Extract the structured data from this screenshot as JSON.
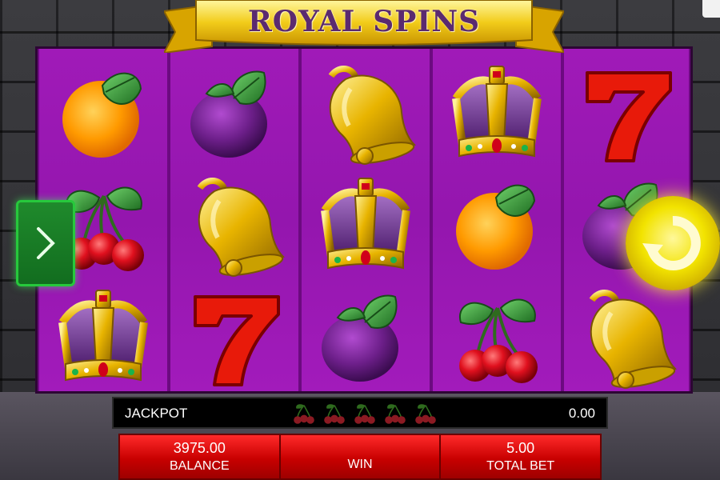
{
  "game": {
    "title": "ROYAL SPINS",
    "colors": {
      "reel": "#9c18b4",
      "accent": "#f4d000",
      "panel": "#e00000"
    }
  },
  "reels": [
    [
      "orange",
      "cherries",
      "crown"
    ],
    [
      "plum",
      "bell",
      "seven"
    ],
    [
      "bell",
      "crown",
      "plum"
    ],
    [
      "crown",
      "orange",
      "cherries"
    ],
    [
      "seven",
      "plum",
      "bell"
    ]
  ],
  "jackpot": {
    "label": "JACKPOT",
    "value": "0.00"
  },
  "panel": {
    "balance_value": "3975.00",
    "balance_label": "BALANCE",
    "win_value": "",
    "win_label": "WIN",
    "bet_value": "5.00",
    "bet_label": "TOTAL BET"
  },
  "controls": {
    "next_icon": "chevron-right-icon",
    "spin_icon": "spin-arrow-icon"
  }
}
